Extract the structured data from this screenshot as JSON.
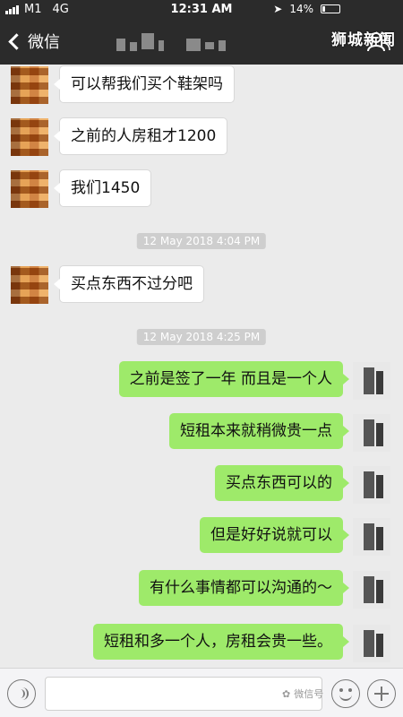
{
  "status_bar": {
    "carrier": "M1",
    "network": "4G",
    "time": "12:31 AM",
    "battery": "14%"
  },
  "nav": {
    "back_label": "微信",
    "watermark": "狮城新闻"
  },
  "messages": [
    {
      "side": "in",
      "text": "可以帮我们买个鞋架吗"
    },
    {
      "side": "in",
      "text": "之前的人房租才1200"
    },
    {
      "side": "in",
      "text": "我们1450"
    },
    {
      "kind": "time",
      "text": "12 May 2018 4:04 PM"
    },
    {
      "side": "in",
      "text": "买点东西不过分吧"
    },
    {
      "kind": "time",
      "text": "12 May 2018 4:25 PM"
    },
    {
      "side": "out",
      "text": "之前是签了一年 而且是一个人"
    },
    {
      "side": "out",
      "text": "短租本来就稍微贵一点"
    },
    {
      "side": "out",
      "text": "买点东西可以的"
    },
    {
      "side": "out",
      "text": "但是好好说就可以"
    },
    {
      "side": "out",
      "text": "有什么事情都可以沟通的～"
    },
    {
      "side": "out",
      "text": "短租和多一个人，房租会贵一些。"
    }
  ],
  "input_bar": {
    "watermark": "微信号"
  },
  "colors": {
    "header": "#2b2b2b",
    "chat_background": "#ebebeb",
    "outgoing_bubble": "#9eea6a",
    "incoming_bubble": "#ffffff"
  }
}
